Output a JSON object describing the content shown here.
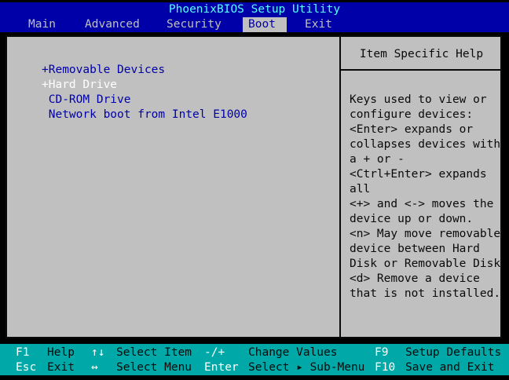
{
  "title": "PhoenixBIOS Setup Utility",
  "menu": [
    {
      "label": "Main",
      "active": false
    },
    {
      "label": "Advanced",
      "active": false
    },
    {
      "label": "Security",
      "active": false
    },
    {
      "label": "Boot",
      "active": true
    },
    {
      "label": "Exit",
      "active": false
    }
  ],
  "boot_list": [
    {
      "label": "+Removable Devices",
      "selected": false
    },
    {
      "label": "+Hard Drive",
      "selected": true
    },
    {
      "label": " CD-ROM Drive",
      "selected": false
    },
    {
      "label": " Network boot from Intel E1000",
      "selected": false
    }
  ],
  "help": {
    "title": "Item Specific Help",
    "lines": [
      "Keys used to view or",
      "configure devices:",
      "<Enter> expands or",
      "collapses devices with",
      "a + or -",
      "<Ctrl+Enter> expands",
      "all",
      "<+> and <-> moves the",
      "device up or down.",
      "<n> May move removable",
      "device between Hard",
      "Disk or Removable Disk",
      "<d> Remove a device",
      "that is not installed."
    ]
  },
  "status": {
    "row1": {
      "k1": "F1",
      "d1": "Help",
      "k2": "↑↓",
      "d2": "Select Item",
      "k3": "-/+",
      "d3": "Change Values",
      "k4": "F9",
      "d4": "Setup Defaults"
    },
    "row2": {
      "k1": "Esc",
      "d1": "Exit",
      "k2": "↔",
      "d2": "Select Menu",
      "k3": "Enter",
      "d3": "Select ▸ Sub-Menu",
      "k4": "F10",
      "d4": "Save and Exit"
    }
  },
  "colors": {
    "bios_blue": "#0000a8",
    "panel_gray": "#c0c0c0",
    "status_cyan": "#00a8a8",
    "title_cyan": "#55ffff"
  }
}
